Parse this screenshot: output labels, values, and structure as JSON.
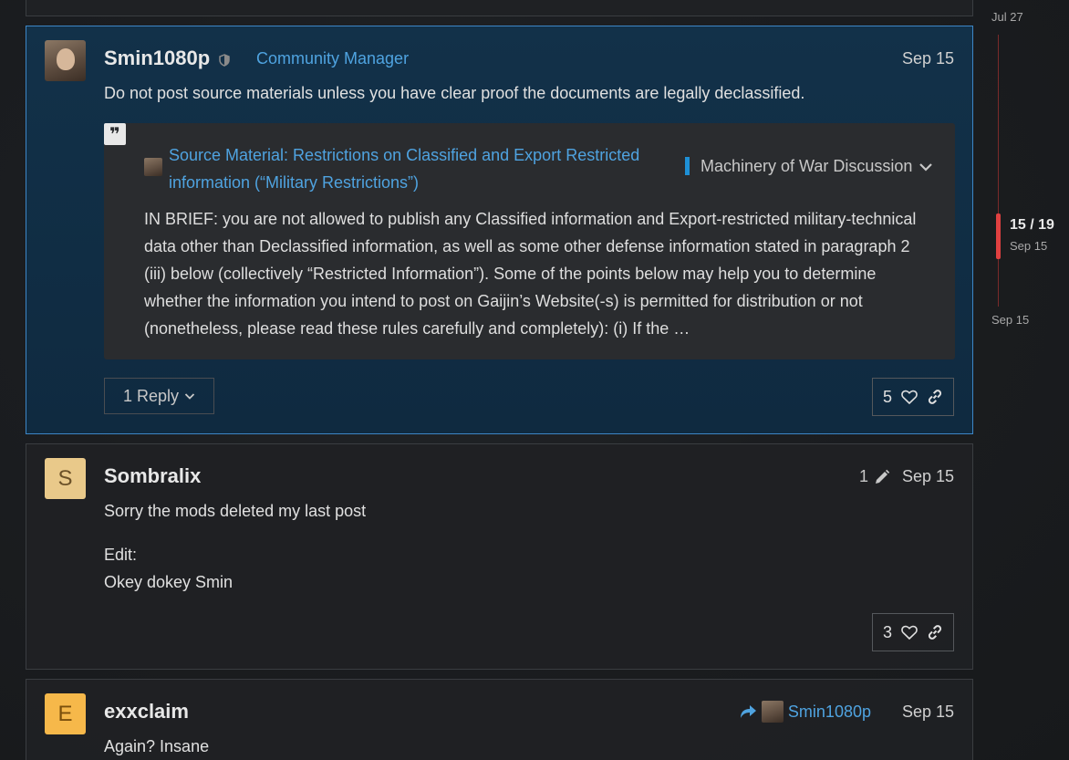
{
  "timeline": {
    "top_date": "Jul 27",
    "position": "15 / 19",
    "position_date": "Sep 15",
    "bottom_date": "Sep 15"
  },
  "posts": [
    {
      "username": "Smin1080p",
      "user_title": "Community Manager",
      "date": "Sep 15",
      "text": "Do not post source materials unless you have clear proof the documents are legally declassified.",
      "quote": {
        "title": "Source Material: Restrictions on Classified and Export Restricted information (“Military Restrictions”)",
        "category": "Machinery of War Discussion",
        "body": "IN BRIEF: you are not allowed to publish any Classified information and Export-restricted military-technical data other than Declassified information, as well as some other defense information stated in paragraph 2 (iii) below (collectively “Restricted Information”). Some of the points below may help you to determine whether the information you intend to post on Gaijin’s Website(-s) is permitted for distribution or not (nonetheless, please read these rules carefully and completely): (i) If the …"
      },
      "reply_label": "1 Reply",
      "likes": "5"
    },
    {
      "avatar_letter": "S",
      "username": "Sombralix",
      "edit_count": "1",
      "date": "Sep 15",
      "text_line1": "Sorry the mods deleted my last post",
      "text_line2": "Edit:",
      "text_line3": "Okey dokey Smin",
      "likes": "3"
    },
    {
      "avatar_letter": "E",
      "username": "exxclaim",
      "reply_to": "Smin1080p",
      "date": "Sep 15",
      "text": "Again? Insane"
    }
  ],
  "colors": {
    "accent_blue": "#4fa3e0",
    "highlight_border": "#3d86c6",
    "category_badge": "#1e90d6",
    "timeline_handle": "#e04040"
  }
}
